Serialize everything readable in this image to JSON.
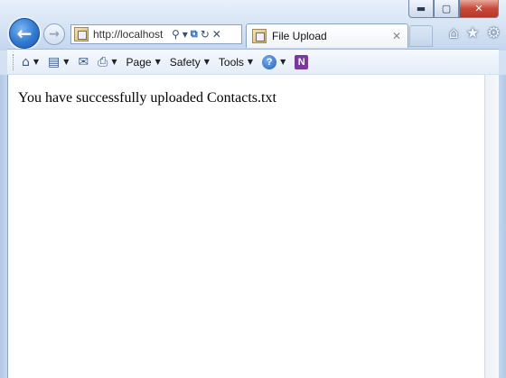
{
  "window": {
    "minimize_glyph": "▬",
    "maximize_glyph": "▢",
    "close_glyph": "✕"
  },
  "nav": {
    "back_glyph": "←",
    "forward_glyph": "→"
  },
  "address": {
    "url": "http://localhost",
    "search_glyph": "⚲",
    "dropdown_glyph": "▾",
    "compat_glyph": "⧉",
    "refresh_glyph": "↻",
    "stop_glyph": "✕"
  },
  "tab": {
    "title": "File Upload",
    "close_glyph": "✕"
  },
  "toolbar_icons": {
    "home_glyph": "⌂",
    "favorites_glyph": "★",
    "tools_glyph": "⚙"
  },
  "command_bar": {
    "home_glyph": "⌂",
    "feeds_glyph": "▤",
    "mail_glyph": "✉",
    "print_glyph": "⎙",
    "arrow_glyph": "▼",
    "page_label": "Page",
    "safety_label": "Safety",
    "tools_label": "Tools",
    "help_glyph": "?",
    "onenote_glyph": "N"
  },
  "content": {
    "message": "You have successfully uploaded Contacts.txt"
  }
}
